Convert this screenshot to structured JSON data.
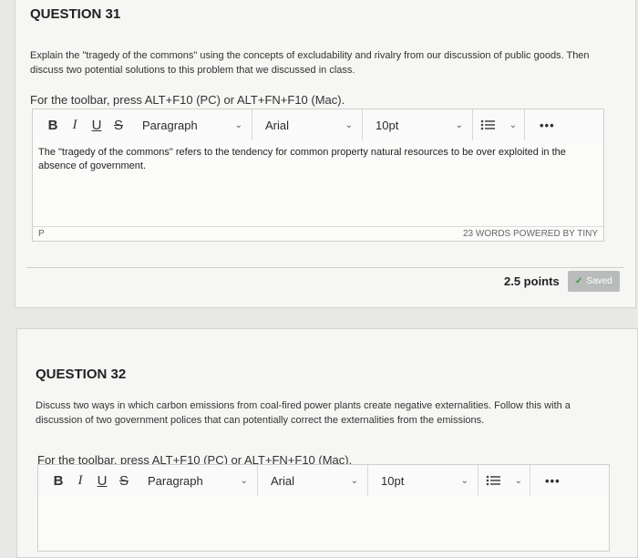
{
  "q31": {
    "title": "QUESTION 31",
    "prompt": "Explain the \"tragedy of the commons\" using the concepts of excludability and rivalry from our discussion of public goods. Then discuss two potential solutions to this problem that we discussed in class.",
    "toolbar_hint": "For the toolbar, press ALT+F10 (PC) or ALT+FN+F10 (Mac).",
    "toolbar": {
      "bold": "B",
      "italic": "I",
      "underline": "U",
      "strike": "S",
      "block_format": "Paragraph",
      "font": "Arial",
      "size": "10pt",
      "more": "•••"
    },
    "answer": "The \"tragedy of the commons\" refers to the tendency for common property natural resources to be over exploited in the absence of government.",
    "path": "P",
    "word_count": "23 WORDS",
    "powered_by": "POWERED BY TINY",
    "points": "2.5 points",
    "saved": "Saved"
  },
  "q32": {
    "title": "QUESTION 32",
    "prompt": "Discuss two ways in which carbon emissions from coal-fired power plants create negative externalities. Follow this with a discussion of two government polices that can potentially correct the externalities from the emissions.",
    "toolbar_hint": "For the toolbar, press ALT+F10 (PC) or ALT+FN+F10 (Mac).",
    "toolbar": {
      "bold": "B",
      "italic": "I",
      "underline": "U",
      "strike": "S",
      "block_format": "Paragraph",
      "font": "Arial",
      "size": "10pt",
      "more": "•••"
    }
  }
}
